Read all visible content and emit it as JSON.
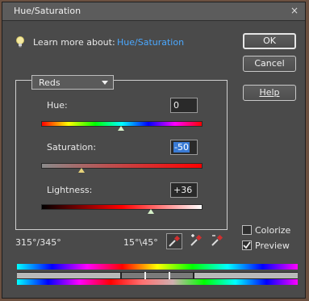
{
  "dialog": {
    "title": "Hue/Saturation",
    "close_glyph": "×",
    "learn_more_label": "Learn more about:",
    "learn_more_link": "Hue/Saturation",
    "icon_names": [
      "lightbulb-icon",
      "close-icon",
      "chevron-down-icon",
      "eyedropper-icon",
      "eyedropper-plus-icon",
      "eyedropper-minus-icon",
      "checkmark-icon"
    ]
  },
  "buttons": {
    "ok": "OK",
    "cancel": "Cancel",
    "help": "Help"
  },
  "edit": {
    "selected": "Reds"
  },
  "sliders": {
    "hue": {
      "label": "Hue:",
      "value": "0",
      "position_fraction": 0.5
    },
    "saturation": {
      "label": "Saturation:",
      "value": "-50",
      "position_fraction": 0.25
    },
    "lightness": {
      "label": "Lightness:",
      "value": "+36",
      "position_fraction": 0.68
    }
  },
  "range": {
    "left": "315°/345°",
    "right": "15°\\45°"
  },
  "options": {
    "colorize": {
      "label": "Colorize",
      "checked": false
    },
    "preview": {
      "label": "Preview",
      "checked": true
    }
  },
  "colors": {
    "dialog_bg": "#4a4a4a",
    "link": "#4aa8ff",
    "selection": "#3a7bd5"
  }
}
